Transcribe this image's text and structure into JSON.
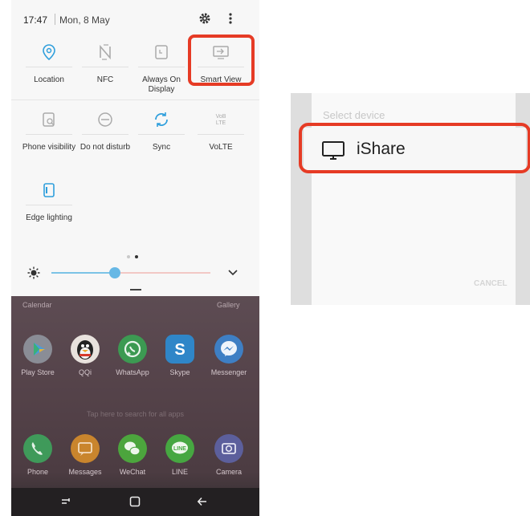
{
  "status": {
    "time": "17:47",
    "date": "Mon, 8 May"
  },
  "tiles": [
    {
      "label": "Location",
      "icon": "location-icon"
    },
    {
      "label": "NFC",
      "icon": "nfc-icon"
    },
    {
      "label": "Always On Display",
      "icon": "always-on-display-icon"
    },
    {
      "label": "Smart View",
      "icon": "smart-view-icon"
    },
    {
      "label": "Phone visibility",
      "icon": "phone-visibility-icon"
    },
    {
      "label": "Do not disturb",
      "icon": "do-not-disturb-icon"
    },
    {
      "label": "Sync",
      "icon": "sync-icon"
    },
    {
      "label": "VoLTE",
      "icon": "volte-icon"
    },
    {
      "label": "Edge lighting",
      "icon": "edge-lighting-icon"
    }
  ],
  "brightness": {
    "level": 0.4
  },
  "home": {
    "widgets": {
      "left": "Calendar",
      "right": "Gallery"
    },
    "apps_row1": [
      "Play Store",
      "QQi",
      "WhatsApp",
      "Skype",
      "Messenger"
    ],
    "hint": "Tap here to search for all apps",
    "apps_row2": [
      "Phone",
      "Messages",
      "WeChat",
      "LINE",
      "Camera"
    ]
  },
  "dialog": {
    "title": "Select device",
    "device": "iShare",
    "cancel": "CANCEL"
  },
  "colors": {
    "highlight": "#e63b25",
    "accent": "#2f9fdc"
  }
}
